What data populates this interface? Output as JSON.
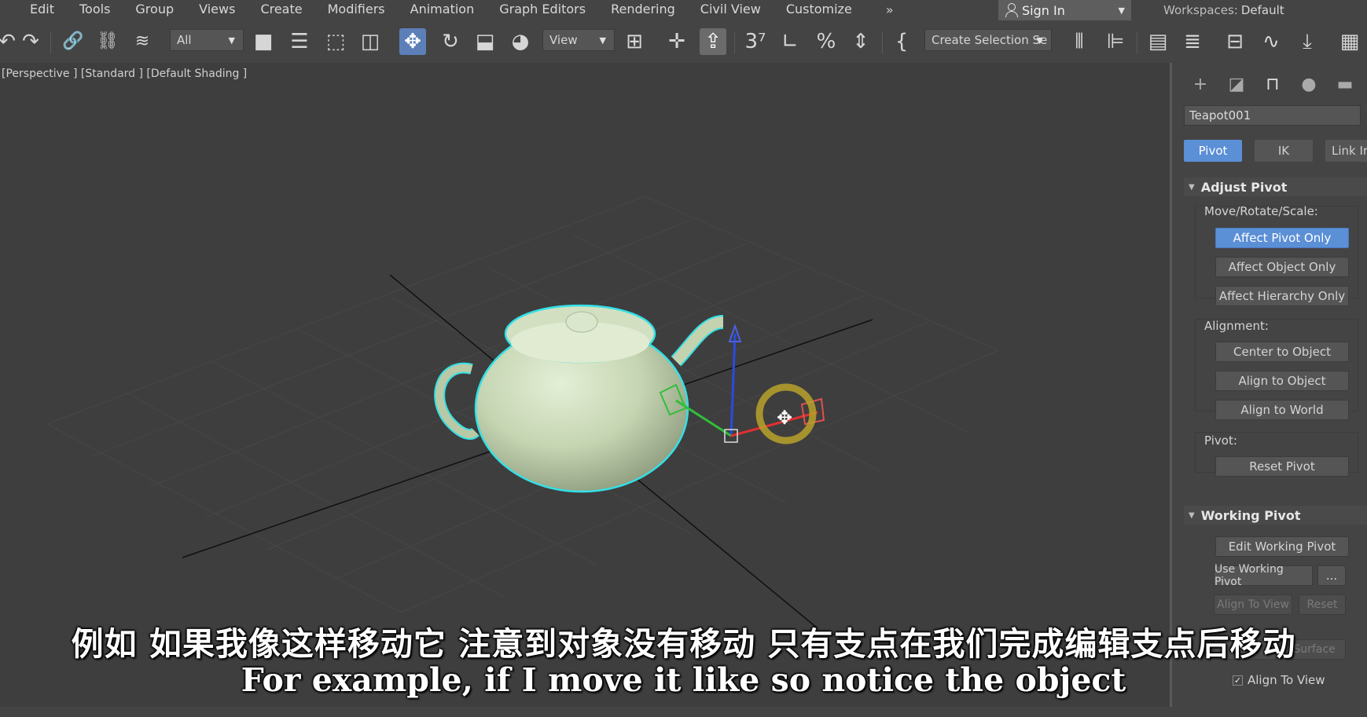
{
  "menu": {
    "items": [
      "Edit",
      "Tools",
      "Group",
      "Views",
      "Create",
      "Modifiers",
      "Animation",
      "Graph Editors",
      "Rendering",
      "Civil View",
      "Customize"
    ],
    "overflow": "»",
    "sign_in": "Sign In",
    "workspaces_label": "Workspaces:",
    "workspace_value": "Default"
  },
  "toolbar": {
    "filter_value": "All",
    "reference_coord_value": "View",
    "named_selection_value": "Create Selection Se",
    "angle_snap_label": "3",
    "icons": [
      "undo-icon",
      "redo-icon",
      "link-icon",
      "unlink-icon",
      "bind-space-warp-icon",
      "select-object-icon",
      "select-by-name-icon",
      "rectangular-selection-icon",
      "window-crossing-icon",
      "select-and-move-icon",
      "select-and-rotate-icon",
      "select-and-scale-icon",
      "select-and-place-icon",
      "use-pivot-center-icon",
      "select-manipulate-icon",
      "keyboard-shortcut-override-icon",
      "snaps-toggle-icon",
      "angle-snap-icon",
      "percent-snap-icon",
      "spinner-snap-icon",
      "edit-named-selection-icon",
      "mirror-icon",
      "align-icon",
      "scene-explorer-icon",
      "layer-explorer-icon",
      "ribbon-icon",
      "curve-editor-icon",
      "schematic-view-icon",
      "material-editor-icon"
    ]
  },
  "viewport": {
    "label": "[Perspective ] [Standard ] [Default Shading ]",
    "selected_object_outline": "#33e0e6",
    "teapot_color": "#c9d9b8",
    "background": "#3e3e3e",
    "gizmo": {
      "x_color": "#e03030",
      "y_color": "#2fbf3a",
      "z_color": "#2a4be0",
      "ring_color": "#b9a22a"
    }
  },
  "panel": {
    "tabs": [
      "create-icon",
      "modify-icon",
      "hierarchy-icon",
      "motion-icon",
      "display-icon"
    ],
    "object_name": "Teapot001",
    "subtabs": [
      "Pivot",
      "IK",
      "Link Ir"
    ],
    "adjust_pivot": {
      "title": "Adjust Pivot",
      "move_label": "Move/Rotate/Scale:",
      "affect_pivot_only": "Affect Pivot Only",
      "affect_object_only": "Affect Object Only",
      "affect_hierarchy_only": "Affect Hierarchy Only",
      "alignment_label": "Alignment:",
      "center_to_object": "Center to Object",
      "align_to_object": "Align to Object",
      "align_to_world": "Align to World",
      "pivot_label": "Pivot:",
      "reset_pivot": "Reset Pivot"
    },
    "working_pivot": {
      "title": "Working Pivot",
      "edit_working_pivot": "Edit Working Pivot",
      "use_working_pivot": "Use Working Pivot",
      "more": "...",
      "align_to_view_btn": "Align To View",
      "reset": "Reset",
      "view": "View",
      "surface": "Surface",
      "align_to_view_check": "Align To View"
    }
  },
  "subtitles": {
    "chinese": "例如 如果我像这样移动它 注意到对象没有移动 只有支点在我们完成编辑支点后移动",
    "english": "For example, if I move it like so notice the object"
  }
}
